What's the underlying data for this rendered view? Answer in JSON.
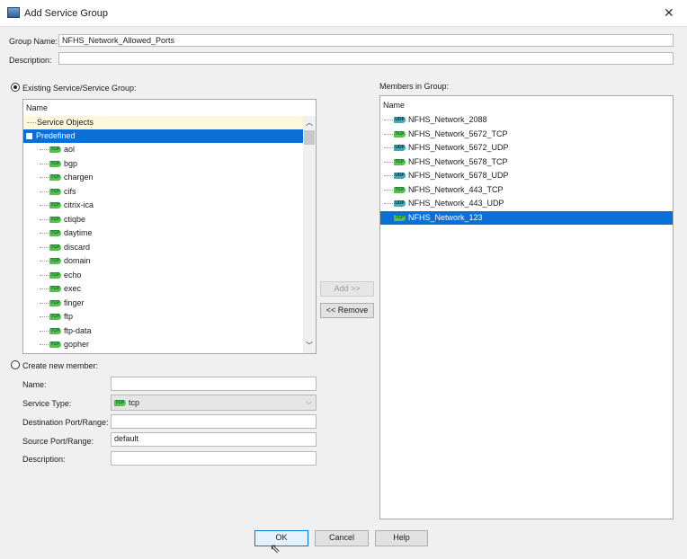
{
  "window": {
    "title": "Add Service Group",
    "close": "✕"
  },
  "group_name": {
    "label": "Group Name:",
    "value": "NFHS_Network_Allowed_Ports"
  },
  "description": {
    "label": "Description:",
    "value": ""
  },
  "existing": {
    "label": "Existing Service/Service Group:",
    "selected": true,
    "column": "Name",
    "root_items": [
      {
        "label": "Service Objects"
      },
      {
        "label": "Predefined",
        "expander": "⊟"
      }
    ],
    "children": [
      "aol",
      "bgp",
      "chargen",
      "cifs",
      "citrix-ica",
      "ctiqbe",
      "daytime",
      "discard",
      "domain",
      "echo",
      "exec",
      "finger",
      "ftp",
      "ftp-data",
      "gopher"
    ],
    "child_icon": "tcp"
  },
  "members": {
    "label": "Members in Group:",
    "column": "Name",
    "items": [
      {
        "name": "NFHS_Network_2088",
        "icon": "udp"
      },
      {
        "name": "NFHS_Network_5672_TCP",
        "icon": "tcp"
      },
      {
        "name": "NFHS_Network_5672_UDP",
        "icon": "udp"
      },
      {
        "name": "NFHS_Network_5678_TCP",
        "icon": "tcp"
      },
      {
        "name": "NFHS_Network_5678_UDP",
        "icon": "udp"
      },
      {
        "name": "NFHS_Network_443_TCP",
        "icon": "tcp"
      },
      {
        "name": "NFHS_Network_443_UDP",
        "icon": "udp"
      },
      {
        "name": "NFHS_Network_123",
        "icon": "tcp",
        "selected": true
      }
    ]
  },
  "transfer": {
    "add": "Add >>",
    "remove": "<< Remove"
  },
  "create": {
    "label": "Create new member:",
    "selected": false,
    "name_label": "Name:",
    "name_value": "",
    "type_label": "Service Type:",
    "type_value": "tcp",
    "dest_label": "Destination Port/Range:",
    "dest_value": "",
    "src_label": "Source Port/Range:",
    "src_value": "default",
    "desc_label": "Description:",
    "desc_value": ""
  },
  "buttons": {
    "ok": "OK",
    "cancel": "Cancel",
    "help": "Help"
  },
  "colors": {
    "selection": "#0a6fd6",
    "tcp_icon": "#58c04a",
    "udp_icon": "#4aa6b0"
  }
}
